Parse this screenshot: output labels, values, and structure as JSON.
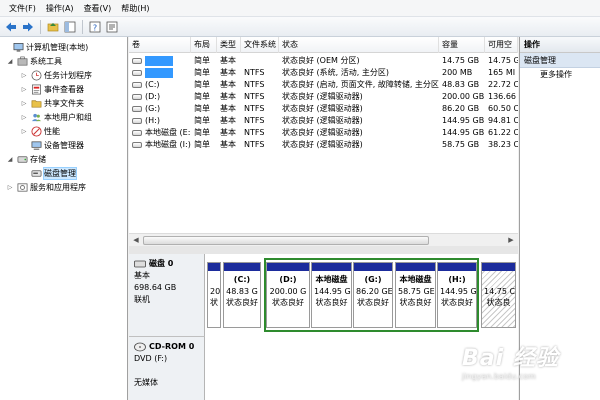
{
  "menu": [
    "文件(F)",
    "操作(A)",
    "查看(V)",
    "帮助(H)"
  ],
  "toolbar": [
    "back-arrow-icon",
    "forward-arrow-icon",
    "up-folder-icon",
    "console-tree-icon",
    "help-icon",
    "properties-icon",
    "export-icon"
  ],
  "tree": {
    "root": "计算机管理(本地)",
    "system_tools": "系统工具",
    "task_scheduler": "任务计划程序",
    "event_viewer": "事件查看器",
    "shared_folders": "共享文件夹",
    "local_users": "本地用户和组",
    "performance": "性能",
    "device_manager": "设备管理器",
    "storage": "存储",
    "disk_management": "磁盘管理",
    "services": "服务和应用程序"
  },
  "columns": [
    "卷",
    "布局",
    "类型",
    "文件系统",
    "状态",
    "容量",
    "可用空"
  ],
  "volumes": [
    {
      "name": "",
      "layout": "简单",
      "type": "基本",
      "fs": "",
      "status": "状态良好 (OEM 分区)",
      "capacity": "14.75 GB",
      "free": "14.75 G"
    },
    {
      "name": "",
      "layout": "简单",
      "type": "基本",
      "fs": "NTFS",
      "status": "状态良好 (系统, 活动, 主分区)",
      "capacity": "200 MB",
      "free": "165 MI"
    },
    {
      "name": "(C:)",
      "layout": "简单",
      "type": "基本",
      "fs": "NTFS",
      "status": "状态良好 (启动, 页面文件, 故障转储, 主分区)",
      "capacity": "48.83 GB",
      "free": "22.72 C"
    },
    {
      "name": "(D:)",
      "layout": "简单",
      "type": "基本",
      "fs": "NTFS",
      "status": "状态良好 (逻辑驱动器)",
      "capacity": "200.00 GB",
      "free": "136.66"
    },
    {
      "name": "(G:)",
      "layout": "简单",
      "type": "基本",
      "fs": "NTFS",
      "status": "状态良好 (逻辑驱动器)",
      "capacity": "86.20 GB",
      "free": "60.50 C"
    },
    {
      "name": "(H:)",
      "layout": "简单",
      "type": "基本",
      "fs": "NTFS",
      "status": "状态良好 (逻辑驱动器)",
      "capacity": "144.95 GB",
      "free": "94.81 C"
    },
    {
      "name": "本地磁盘 (E:)",
      "layout": "简单",
      "type": "基本",
      "fs": "NTFS",
      "status": "状态良好 (逻辑驱动器)",
      "capacity": "144.95 GB",
      "free": "61.22 C"
    },
    {
      "name": "本地磁盘 (I:)",
      "layout": "简单",
      "type": "基本",
      "fs": "NTFS",
      "status": "状态良好 (逻辑驱动器)",
      "capacity": "58.75 GB",
      "free": "38.23 C"
    }
  ],
  "disk0": {
    "title": "磁盘 0",
    "type": "基本",
    "size": "698.64 GB",
    "state": "联机"
  },
  "partitions": [
    {
      "label": "",
      "size": "20",
      "status": "状"
    },
    {
      "label": "(C:)",
      "size": "48.83 G",
      "status": "状态良好"
    },
    {
      "label": "(D:)",
      "size": "200.00 G",
      "status": "状态良好"
    },
    {
      "label": "本地磁盘",
      "size": "144.95 G",
      "status": "状态良好"
    },
    {
      "label": "(G:)",
      "size": "86.20 GE",
      "status": "状态良好"
    },
    {
      "label": "本地磁盘",
      "size": "58.75 GE",
      "status": "状态良好"
    },
    {
      "label": "(H:)",
      "size": "144.95 G",
      "status": "状态良好"
    },
    {
      "label": "",
      "size": "14.75 C",
      "status": "状态良"
    }
  ],
  "cdrom": {
    "title": "CD-ROM 0",
    "type": "DVD (F:)",
    "state": "无媒体"
  },
  "actions": {
    "header": "操作",
    "section": "磁盘管理",
    "more": "更多操作"
  },
  "watermark": {
    "brand": "Bai 经验",
    "url": "jingyan.baidu.com"
  },
  "colors": {
    "primary_partition_bar": "#1c2c9c",
    "extended_border": "#2e8b2e",
    "selection": "#3399ff"
  }
}
